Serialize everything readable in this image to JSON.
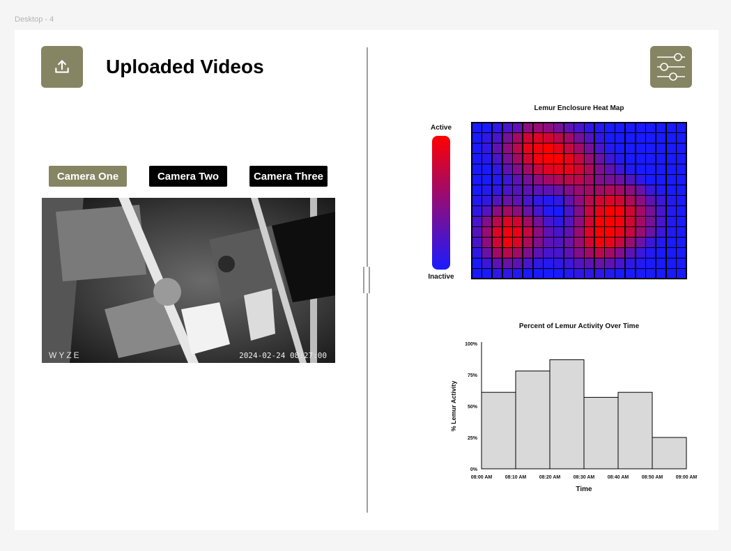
{
  "frame": {
    "label": "Desktop - 4"
  },
  "header": {
    "title": "Uploaded Videos",
    "upload_icon": "upload-icon",
    "filter_icon": "sliders-icon",
    "accent_color": "#858563"
  },
  "cameras": [
    {
      "label": "Camera One",
      "active": true,
      "color": "#858563"
    },
    {
      "label": "Camera Two",
      "active": false,
      "color": "#000000"
    },
    {
      "label": "Camera Three",
      "active": false,
      "color": "#000000"
    }
  ],
  "video": {
    "watermark": "WYZE",
    "timestamp": "2024-02-24 08:27:00"
  },
  "heatmap": {
    "title": "Lemur Enclosure Heat Map",
    "legend_high": "Active",
    "legend_low": "Inactive",
    "high_color": "#ff0000",
    "low_color": "#1a1aff"
  },
  "chart_data": [
    {
      "type": "heatmap",
      "title": "Lemur Enclosure Heat Map",
      "legend": [
        "Active",
        "Inactive"
      ],
      "rows": 15,
      "cols": 21,
      "values": [
        [
          0,
          0,
          0.1,
          0.2,
          0.3,
          0.5,
          0.55,
          0.5,
          0.4,
          0.3,
          0.2,
          0.1,
          0.05,
          0,
          0,
          0,
          0,
          0,
          0,
          0,
          0
        ],
        [
          0,
          0.1,
          0.2,
          0.4,
          0.6,
          0.8,
          0.85,
          0.8,
          0.7,
          0.6,
          0.4,
          0.25,
          0.1,
          0,
          0,
          0,
          0,
          0,
          0,
          0,
          0
        ],
        [
          0,
          0.1,
          0.3,
          0.5,
          0.7,
          0.9,
          0.95,
          1,
          0.9,
          0.75,
          0.6,
          0.4,
          0.2,
          0.05,
          0,
          0,
          0,
          0,
          0,
          0,
          0
        ],
        [
          0,
          0.05,
          0.2,
          0.4,
          0.6,
          0.8,
          0.95,
          1,
          1,
          0.9,
          0.75,
          0.55,
          0.35,
          0.15,
          0.05,
          0,
          0,
          0,
          0,
          0,
          0
        ],
        [
          0,
          0,
          0.1,
          0.3,
          0.45,
          0.6,
          0.75,
          0.85,
          0.9,
          0.9,
          0.8,
          0.65,
          0.45,
          0.3,
          0.15,
          0.05,
          0,
          0,
          0,
          0,
          0
        ],
        [
          0,
          0,
          0.05,
          0.15,
          0.3,
          0.4,
          0.5,
          0.6,
          0.65,
          0.7,
          0.7,
          0.6,
          0.45,
          0.4,
          0.35,
          0.25,
          0.1,
          0,
          0,
          0,
          0
        ],
        [
          0,
          0.05,
          0.1,
          0.2,
          0.25,
          0.3,
          0.3,
          0.3,
          0.35,
          0.45,
          0.55,
          0.6,
          0.6,
          0.65,
          0.6,
          0.5,
          0.35,
          0.15,
          0.05,
          0,
          0
        ],
        [
          0.05,
          0.1,
          0.25,
          0.35,
          0.3,
          0.2,
          0.1,
          0.05,
          0.1,
          0.3,
          0.5,
          0.7,
          0.8,
          0.85,
          0.8,
          0.65,
          0.5,
          0.3,
          0.15,
          0.05,
          0
        ],
        [
          0.1,
          0.25,
          0.5,
          0.6,
          0.5,
          0.35,
          0.2,
          0.05,
          0,
          0.2,
          0.45,
          0.75,
          0.9,
          1,
          0.95,
          0.8,
          0.6,
          0.4,
          0.2,
          0.05,
          0
        ],
        [
          0.2,
          0.45,
          0.7,
          0.85,
          0.8,
          0.6,
          0.4,
          0.2,
          0.1,
          0.25,
          0.5,
          0.8,
          1,
          1,
          0.95,
          0.8,
          0.6,
          0.4,
          0.2,
          0.05,
          0
        ],
        [
          0.25,
          0.55,
          0.85,
          0.95,
          0.9,
          0.75,
          0.5,
          0.3,
          0.2,
          0.3,
          0.55,
          0.85,
          1,
          1,
          0.9,
          0.75,
          0.55,
          0.35,
          0.15,
          0.05,
          0
        ],
        [
          0.2,
          0.5,
          0.8,
          0.95,
          0.85,
          0.65,
          0.45,
          0.3,
          0.25,
          0.35,
          0.55,
          0.8,
          0.95,
          0.9,
          0.75,
          0.55,
          0.35,
          0.15,
          0.05,
          0,
          0
        ],
        [
          0.1,
          0.35,
          0.6,
          0.7,
          0.6,
          0.45,
          0.3,
          0.2,
          0.2,
          0.3,
          0.45,
          0.6,
          0.7,
          0.6,
          0.45,
          0.3,
          0.15,
          0.05,
          0,
          0,
          0
        ],
        [
          0,
          0.15,
          0.3,
          0.35,
          0.3,
          0.2,
          0.1,
          0.05,
          0.1,
          0.15,
          0.25,
          0.3,
          0.35,
          0.3,
          0.2,
          0.1,
          0.05,
          0,
          0,
          0,
          0
        ],
        [
          0,
          0,
          0.1,
          0.1,
          0.05,
          0,
          0,
          0,
          0,
          0.05,
          0.1,
          0.1,
          0.1,
          0.05,
          0,
          0,
          0,
          0,
          0,
          0,
          0
        ]
      ]
    },
    {
      "type": "bar",
      "title": "Percent of Lemur Activity Over Time",
      "xlabel": "Time",
      "ylabel": "% Lemur Activity",
      "categories": [
        "08:00 AM",
        "08:10 AM",
        "08:20 AM",
        "08:30 AM",
        "08:40 AM",
        "08:50 AM",
        "09:00 AM"
      ],
      "values": [
        61,
        78,
        87,
        57,
        61,
        25
      ],
      "yticks": [
        "0%",
        "25%",
        "50%",
        "75%",
        "100%"
      ],
      "ylim": [
        0,
        100
      ],
      "bar_color": "#d9d9d9",
      "grid": false
    }
  ]
}
